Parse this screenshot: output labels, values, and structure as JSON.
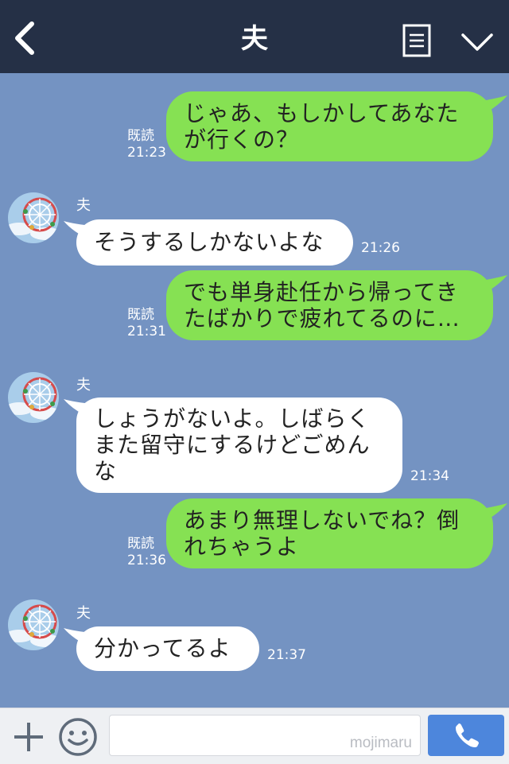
{
  "header": {
    "title": "夫"
  },
  "colors": {
    "header_bg": "#253046",
    "chat_bg": "#7493c2",
    "outgoing_bubble": "#86e153",
    "incoming_bubble": "#ffffff",
    "call_button": "#4d86dc"
  },
  "icons": {
    "back": "back-chevron-icon",
    "menu": "notes-icon",
    "collapse": "chevron-down-icon",
    "add": "plus-icon",
    "emoji": "smiley-icon",
    "call": "phone-icon"
  },
  "messages": [
    {
      "dir": "out",
      "read": "既読",
      "time": "21:23",
      "lines": [
        "じゃあ、もしかしてあなた",
        "が行くの？"
      ]
    },
    {
      "dir": "in",
      "sender": "夫",
      "time": "21:26",
      "lines": [
        "そうするしかないよな"
      ]
    },
    {
      "dir": "out",
      "read": "既読",
      "time": "21:31",
      "lines": [
        "でも単身赴任から帰ってき",
        "たばかりで疲れてるのに…"
      ]
    },
    {
      "dir": "in",
      "sender": "夫",
      "time": "21:34",
      "lines": [
        "しょうがないよ。しばらく",
        "また留守にするけどごめん",
        "な"
      ]
    },
    {
      "dir": "out",
      "read": "既読",
      "time": "21:36",
      "lines": [
        "あまり無理しないでね？倒",
        "れちゃうよ"
      ]
    },
    {
      "dir": "in",
      "sender": "夫",
      "time": "21:37",
      "lines": [
        "分かってるよ"
      ]
    }
  ],
  "footer": {
    "input_value": "",
    "watermark": "mojimaru"
  }
}
